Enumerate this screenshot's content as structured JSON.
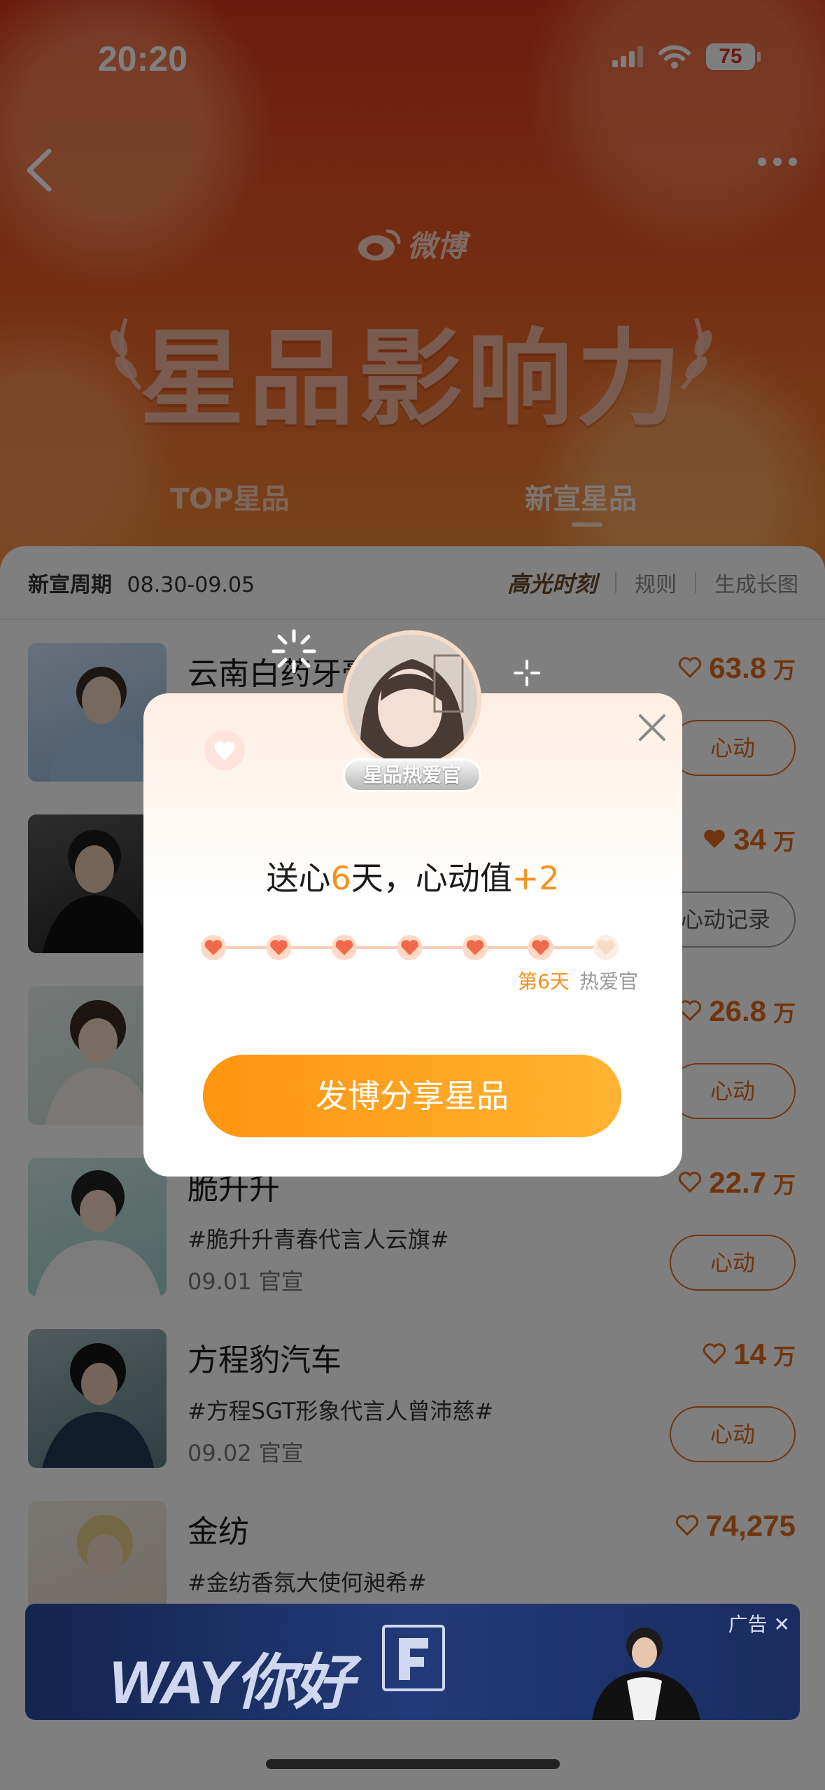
{
  "status_bar": {
    "time": "20:20",
    "battery": "75"
  },
  "header": {
    "logo_text": "微博",
    "title": "星品影响力",
    "tabs": [
      {
        "label": "TOP星品",
        "active": false
      },
      {
        "label": "新宣星品",
        "active": true
      }
    ]
  },
  "week_bar": {
    "label": "新宣周期",
    "range": "08.30-09.05",
    "highlight": "高光时刻",
    "rules": "规则",
    "generate": "生成长图"
  },
  "list": [
    {
      "brand": "云南白药牙膏",
      "tagline": "",
      "date": "",
      "score": "63.8",
      "unit": "万",
      "button": "心动",
      "liked": false
    },
    {
      "brand": "",
      "tagline": "",
      "date": "",
      "score": "34",
      "unit": "万",
      "button": "心动记录",
      "liked": true
    },
    {
      "brand": "",
      "tagline": "",
      "date": "",
      "score": "26.8",
      "unit": "万",
      "button": "心动",
      "liked": false
    },
    {
      "brand": "脆升升",
      "tagline": "#脆升升青春代言人云旗#",
      "date": "09.01 官宣",
      "score": "22.7",
      "unit": "万",
      "button": "心动",
      "liked": false
    },
    {
      "brand": "方程豹汽车",
      "tagline": "#方程SGT形象代言人曾沛慈#",
      "date": "09.02 官宣",
      "score": "14",
      "unit": "万",
      "button": "心动",
      "liked": false
    },
    {
      "brand": "金纺",
      "tagline": "#金纺香氛大使何昶希#",
      "date": "",
      "score": "74,275",
      "unit": "",
      "button": "",
      "liked": false
    }
  ],
  "ad": {
    "slogan": "WAY你好",
    "tag": "广告"
  },
  "popup": {
    "badge": "星品热爱官",
    "title_prefix": "送心",
    "days": "6",
    "title_mid": "天，心动值",
    "bonus": "+2",
    "progress_days_done": 6,
    "progress_days_total": 7,
    "day_caption": "第6天",
    "goal_caption": "热爱官",
    "share_button": "发博分享星品"
  },
  "colors": {
    "accent": "#f5901a",
    "heart": "#f06a4a",
    "score": "#e06a1a"
  }
}
